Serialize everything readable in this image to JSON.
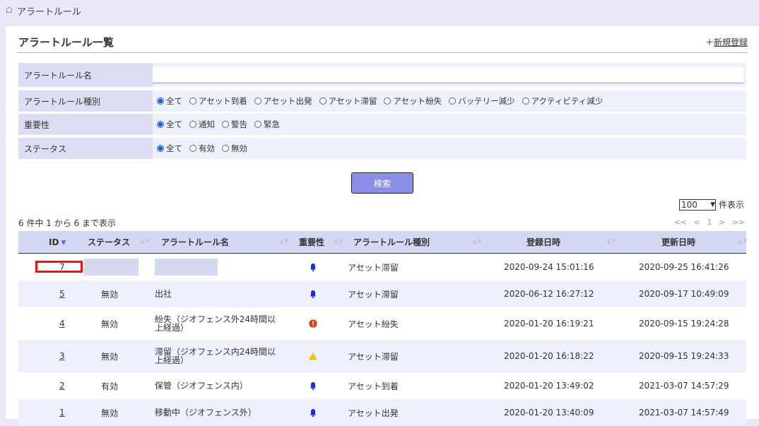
{
  "breadcrumb": {
    "title": "アラートルール"
  },
  "page": {
    "title": "アラートルール一覧",
    "new_prefix": "＋",
    "new_label": "新規登録"
  },
  "filters": {
    "name": {
      "label": "アラートルール名",
      "value": ""
    },
    "type": {
      "label": "アラートルール種別",
      "options": [
        "全て",
        "アセット到着",
        "アセット出発",
        "アセット滞留",
        "アセット紛失",
        "バッテリー減少",
        "アクティビティ減少"
      ],
      "selected": "全て"
    },
    "severity": {
      "label": "重要性",
      "options": [
        "全て",
        "通知",
        "警告",
        "緊急"
      ],
      "selected": "全て"
    },
    "status": {
      "label": "ステータス",
      "options": [
        "全て",
        "有効",
        "無効"
      ],
      "selected": "全て"
    }
  },
  "search_button": "検索",
  "page_size": {
    "value": "100",
    "suffix": "件表示"
  },
  "count_text": "6 件中 1 から 6 まで表示",
  "pager": {
    "first": "<<",
    "prev": "<",
    "current": "1",
    "next": ">",
    "last": ">>"
  },
  "columns": [
    "ID",
    "ステータス",
    "アラートルール名",
    "重要性",
    "アラートルール種別",
    "登録日時",
    "更新日時"
  ],
  "sort_indicator": "▼",
  "rows": [
    {
      "id": "7",
      "status": "",
      "name": "",
      "severity": "notice-bell-icon",
      "type": "アセット滞留",
      "created": "2020-09-24 15:01:16",
      "updated": "2020-09-25 16:41:26"
    },
    {
      "id": "5",
      "status": "無効",
      "name": "出社",
      "severity": "notice-bell-icon",
      "type": "アセット滞留",
      "created": "2020-06-12 16:27:12",
      "updated": "2020-09-17 10:49:09"
    },
    {
      "id": "4",
      "status": "無効",
      "name": "紛失（ジオフェンス外24時間以\n上経過）",
      "severity": "urgent-octagon-icon",
      "type": "アセット紛失",
      "created": "2020-01-20 16:19:21",
      "updated": "2020-09-15 19:24:28"
    },
    {
      "id": "3",
      "status": "無効",
      "name": "滞留（ジオフェンス内24時間以\n上経過）",
      "severity": "warning-triangle-icon",
      "type": "アセット滞留",
      "created": "2020-01-20 16:18:22",
      "updated": "2020-09-15 19:24:33"
    },
    {
      "id": "2",
      "status": "有効",
      "name": "保管（ジオフェンス内）",
      "severity": "notice-bell-icon",
      "type": "アセット到着",
      "created": "2020-01-20 13:49:02",
      "updated": "2021-03-07 14:57:29"
    },
    {
      "id": "1",
      "status": "無効",
      "name": "移動中（ジオフェンス外）",
      "severity": "notice-bell-icon",
      "type": "アセット出発",
      "created": "2020-01-20 13:40:09",
      "updated": "2021-03-07 14:57:49"
    }
  ],
  "colors": {
    "accent": "#8b8fe6",
    "header_bg": "#d5d8f2",
    "highlight": "#e11111",
    "bell": "#1a2bd0",
    "urgent": "#d0451b",
    "warning": "#f5c400"
  }
}
